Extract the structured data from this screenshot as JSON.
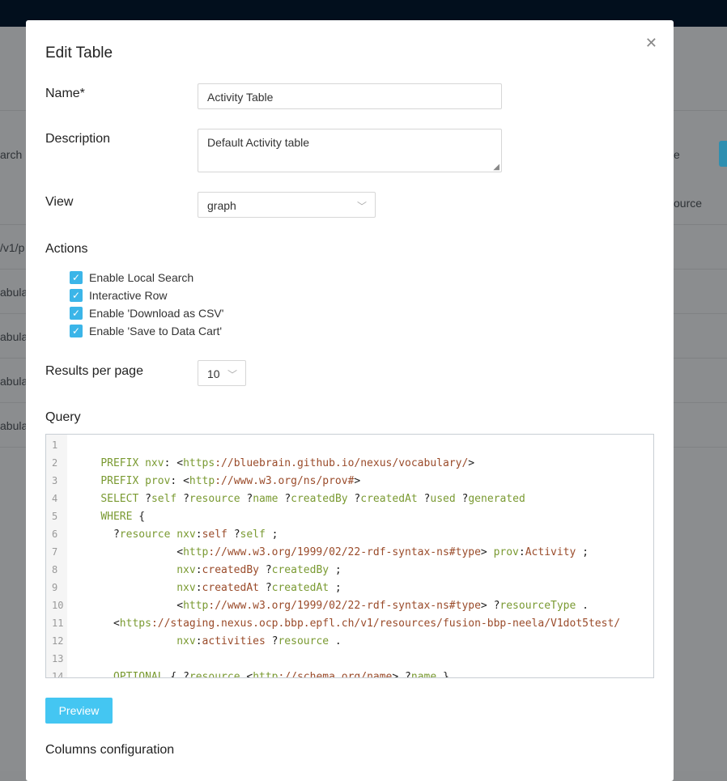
{
  "background": {
    "left_texts": [
      "arch",
      "/v1/p",
      "abula",
      "abula",
      "abula",
      "abula"
    ],
    "right_texts": [
      "e",
      "ource"
    ]
  },
  "modal": {
    "title": "Edit Table",
    "close_icon": "close-icon",
    "name_label": "Name*",
    "name_value": "Activity Table",
    "description_label": "Description",
    "description_value": "Default Activity table",
    "view_label": "View",
    "view_value": "graph",
    "actions_label": "Actions",
    "actions": [
      {
        "label": "Enable Local Search",
        "checked": true
      },
      {
        "label": "Interactive Row",
        "checked": true
      },
      {
        "label": "Enable 'Download as CSV'",
        "checked": true
      },
      {
        "label": "Enable 'Save to Data Cart'",
        "checked": true
      }
    ],
    "results_label": "Results per page",
    "results_value": "10",
    "query_label": "Query",
    "query_lines": [
      "",
      "    PREFIX nxv: <https://bluebrain.github.io/nexus/vocabulary/>",
      "    PREFIX prov: <http://www.w3.org/ns/prov#>",
      "    SELECT ?self ?resource ?name ?createdBy ?createdAt ?used ?generated",
      "    WHERE {",
      "      ?resource nxv:self ?self ;",
      "                <http://www.w3.org/1999/02/22-rdf-syntax-ns#type> prov:Activity ;",
      "                nxv:createdBy ?createdBy ;",
      "                nxv:createdAt ?createdAt ;",
      "                <http://www.w3.org/1999/02/22-rdf-syntax-ns#type> ?resourceType .",
      "      <https://staging.nexus.ocp.bbp.epfl.ch/v1/resources/fusion-bbp-neela/V1dot5test/",
      "                nxv:activities ?resource .",
      "",
      "      OPTIONAL { ?resource <http://schema.org/name> ?name }"
    ],
    "preview_label": "Preview",
    "columns_label": "Columns configuration"
  },
  "colors": {
    "accent": "#44c6f2",
    "keyword": "#7a9a32",
    "url": "#9a4b2a"
  }
}
